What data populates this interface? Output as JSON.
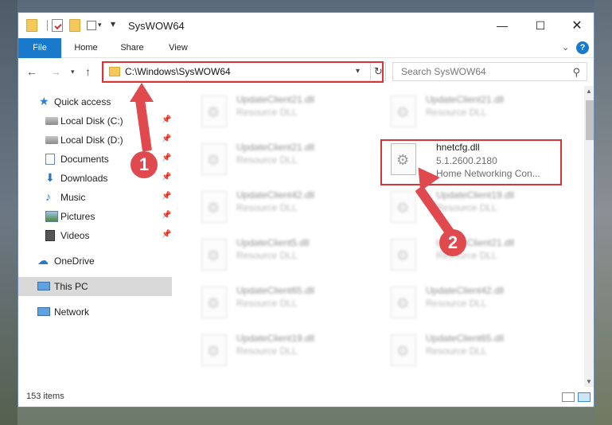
{
  "window": {
    "title": "SysWOW64"
  },
  "ribbon": {
    "tabs": [
      "File",
      "Home",
      "Share",
      "View"
    ],
    "help": "?"
  },
  "nav": {
    "address": "C:\\Windows\\SysWOW64",
    "search_placeholder": "Search SysWOW64"
  },
  "sidebar": {
    "items": [
      {
        "label": "Quick access",
        "icon": "star-icon"
      },
      {
        "label": "Local Disk (C:)",
        "icon": "disk-icon"
      },
      {
        "label": "Local Disk (D:)",
        "icon": "disk-icon"
      },
      {
        "label": "Documents",
        "icon": "documents-icon"
      },
      {
        "label": "Downloads",
        "icon": "download-icon"
      },
      {
        "label": "Music",
        "icon": "music-icon"
      },
      {
        "label": "Pictures",
        "icon": "pictures-icon"
      },
      {
        "label": "Videos",
        "icon": "videos-icon"
      },
      {
        "label": "OneDrive",
        "icon": "cloud-icon"
      },
      {
        "label": "This PC",
        "icon": "computer-icon"
      },
      {
        "label": "Network",
        "icon": "network-icon"
      }
    ]
  },
  "files": {
    "left": [
      {
        "name": "UpdateClient21.dll",
        "type": "Resource DLL"
      },
      {
        "name": "UpdateClient21.dll",
        "type": "Resource DLL"
      },
      {
        "name": "UpdateClient42.dll",
        "type": "Resource DLL"
      },
      {
        "name": "UpdateClient5.dll",
        "type": "Resource DLL"
      },
      {
        "name": "UpdateClient65.dll",
        "type": "Resource DLL"
      },
      {
        "name": "UpdateClient19.dll",
        "type": "Resource DLL"
      }
    ],
    "right_top": {
      "name": "UpdateClient21.dll",
      "type": "Resource DLL"
    },
    "highlighted": {
      "name": "hnetcfg.dll",
      "version": "5.1.2600.2180",
      "description": "Home Networking Con..."
    },
    "right_rest": [
      {
        "name": "UpdateClient19.dll",
        "type": "Resource DLL"
      },
      {
        "name": "UpdateClient21.dll",
        "type": "Resource DLL"
      },
      {
        "name": "UpdateClient42.dll",
        "type": "Resource DLL"
      },
      {
        "name": "UpdateClient65.dll",
        "type": "Resource DLL"
      }
    ]
  },
  "status": {
    "count": "153 items"
  },
  "callouts": {
    "one": "1",
    "two": "2"
  },
  "colors": {
    "accent": "#1979ca",
    "highlight": "#d8353a",
    "arrow": "#e04a4f"
  }
}
